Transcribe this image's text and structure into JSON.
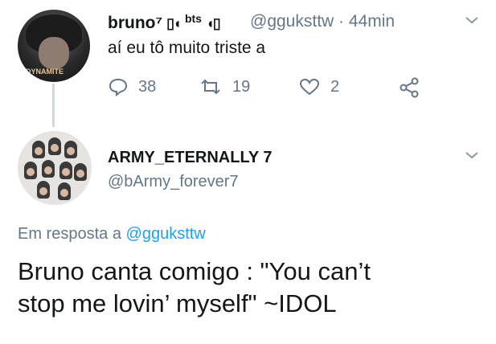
{
  "tweet1": {
    "display_name": "bruno⁷",
    "bts_label": "bts",
    "handle": "@gguksttw",
    "separator": "·",
    "time": "44min",
    "text": "aí eu tô muito triste a",
    "avatar_badge": "DYNAMITE",
    "actions": {
      "reply_count": "38",
      "retweet_count": "19",
      "like_count": "2"
    }
  },
  "tweet2": {
    "display_name": "ARMY_ETERNALLY 7",
    "handle": "@bArmy_forever7",
    "reply_prefix": "Em resposta a",
    "reply_handle": "@gguksttw",
    "text_line1": "Bruno canta comigo : \"You can’t",
    "text_line2": "stop me lovin’ myself\" ~IDOL"
  },
  "colors": {
    "link": "#1da1f2",
    "muted": "#657786",
    "text": "#14171a",
    "thread_line": "#cfd9de"
  },
  "icons": [
    "chevron-down-icon",
    "reply-icon",
    "retweet-icon",
    "like-icon",
    "share-icon"
  ]
}
